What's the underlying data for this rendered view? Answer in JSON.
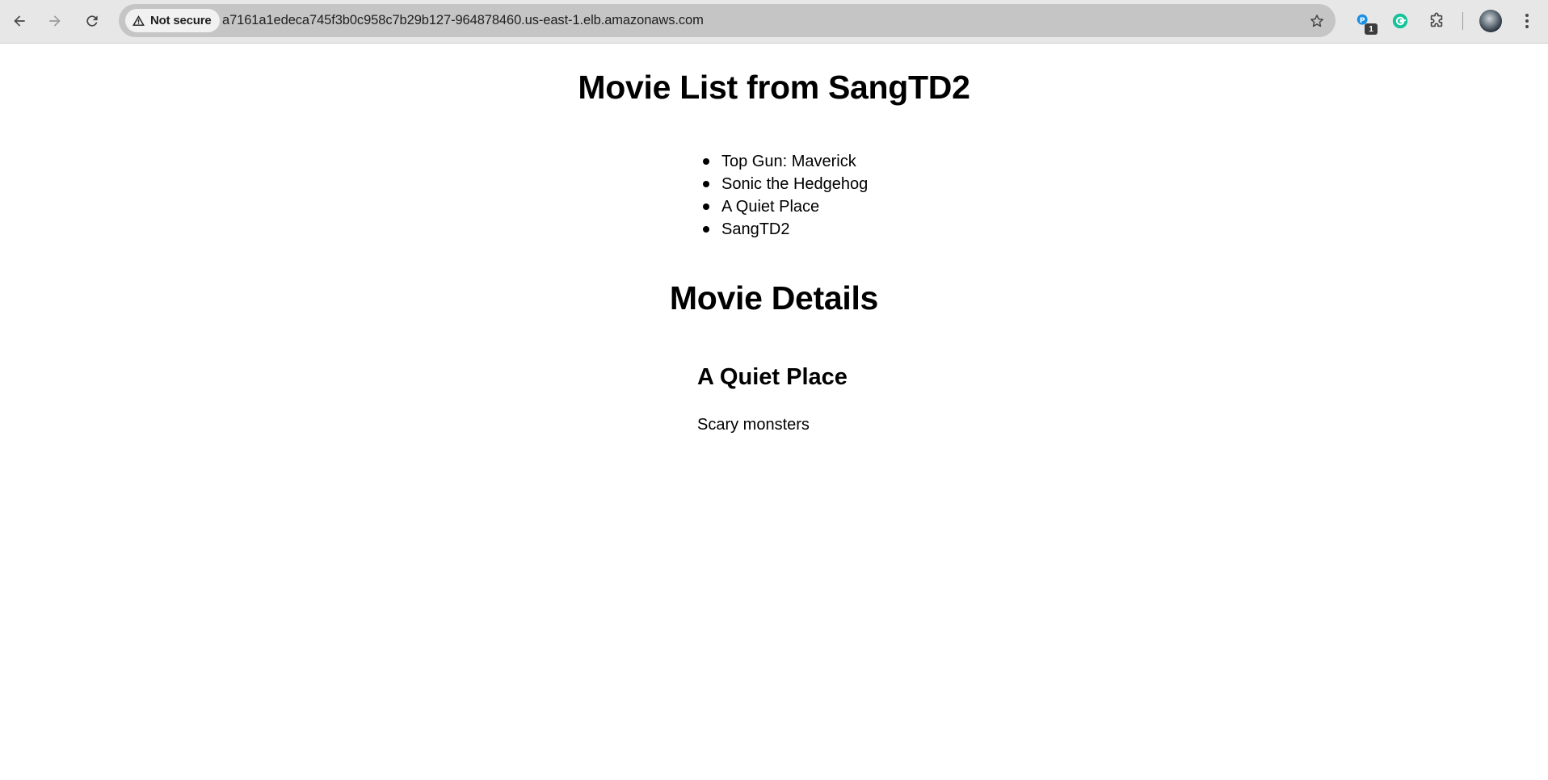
{
  "browser": {
    "security_label": "Not secure",
    "url": "a7161a1edeca745f3b0c958c7b29b127-964878460.us-east-1.elb.amazonaws.com",
    "extension_badge": "1",
    "icons": {
      "back": "arrow-left-icon",
      "forward": "arrow-right-icon",
      "reload": "reload-icon",
      "warning": "warning-triangle-icon",
      "bookmark": "star-icon",
      "extension_1": "blue-extension-icon",
      "extension_2": "grammarly-icon",
      "extensions": "puzzle-icon",
      "menu": "three-dots-vertical-icon"
    },
    "colors": {
      "toolbar": "#e7e7e7",
      "omnibox": "#c5c5c6",
      "grammarly": "#15c39a",
      "extension_blue": "#1a8fe3"
    }
  },
  "page": {
    "title": "Movie List from SangTD2",
    "movies": [
      {
        "name": "Top Gun: Maverick"
      },
      {
        "name": "Sonic the Hedgehog"
      },
      {
        "name": "A Quiet Place"
      },
      {
        "name": "SangTD2"
      }
    ],
    "details_heading": "Movie Details",
    "selected_movie": {
      "title": "A Quiet Place",
      "description": "Scary monsters"
    }
  }
}
